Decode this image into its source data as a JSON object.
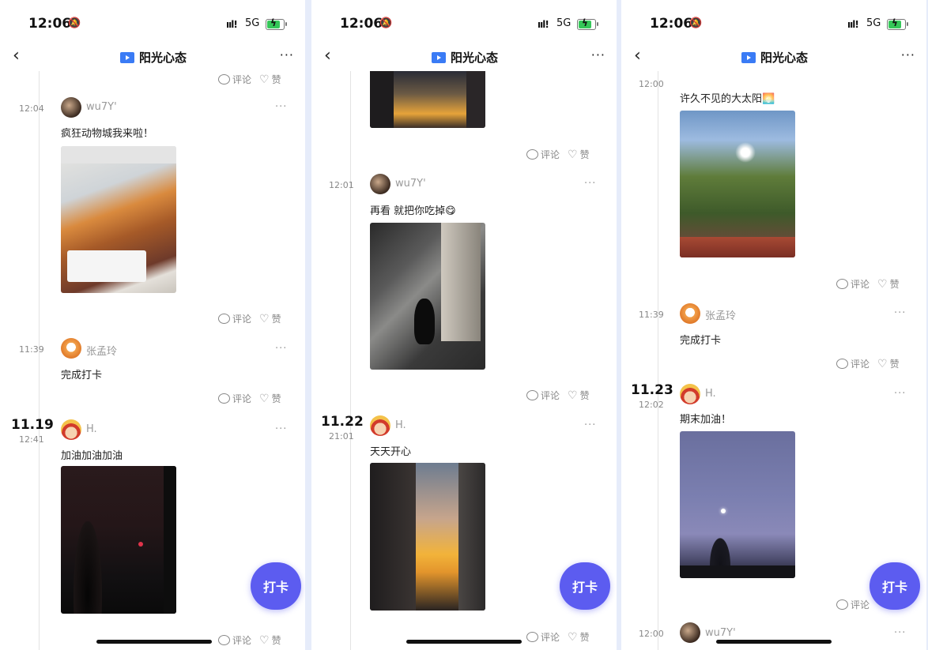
{
  "status": {
    "time": "12:06",
    "signal": "ııl!",
    "network": "5G"
  },
  "nav": {
    "back_icon": "‹",
    "title": "阳光心态",
    "more": "···"
  },
  "actions": {
    "comment": "评论",
    "like": "赞"
  },
  "fab_label": "打卡",
  "panel1": {
    "post1": {
      "time": "12:04",
      "user": "wu7Y'",
      "text": "疯狂动物城我来啦！"
    },
    "post2": {
      "time": "11:39",
      "user": "张孟玲",
      "text": "完成打卡"
    },
    "post3": {
      "date": "11.19",
      "time": "12:41",
      "user": "H.",
      "text": "加油加油加油"
    }
  },
  "panel2": {
    "post1": {
      "time": "12:01",
      "user": "wu7Y'",
      "text": "再看 就把你吃掉😋"
    },
    "post2": {
      "date": "11.22",
      "time": "21:01",
      "user": "H.",
      "text": "天天开心"
    }
  },
  "panel3": {
    "post0": {
      "time": "12:00",
      "text": "许久不见的大太阳🌅"
    },
    "post1": {
      "time": "11:39",
      "user": "张孟玲",
      "text": "完成打卡"
    },
    "post2": {
      "date": "11.23",
      "time": "12:02",
      "user": "H.",
      "text": "期末加油！"
    },
    "post3": {
      "time": "12:00",
      "user": "wu7Y'"
    }
  },
  "colors": {
    "accent": "#5c5cf0",
    "tv_icon": "#3a7bf5",
    "battery": "#35c759"
  }
}
